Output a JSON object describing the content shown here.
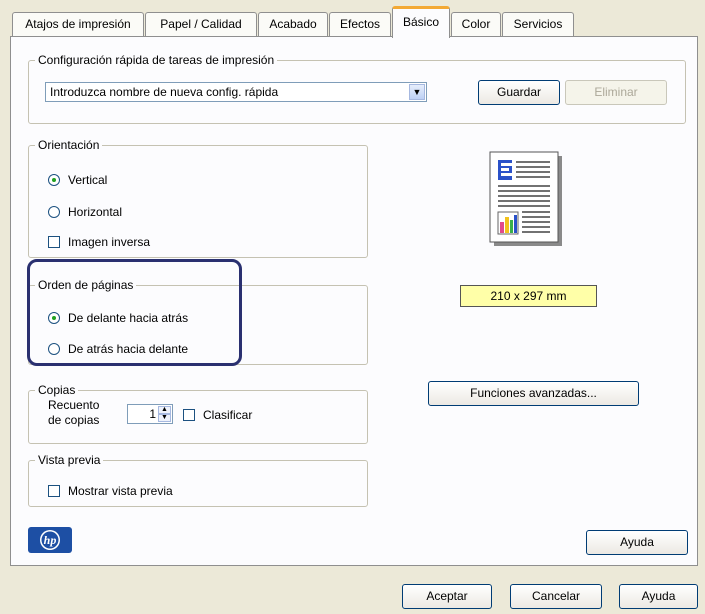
{
  "tabs": [
    {
      "label": "Atajos de impresión",
      "active": false
    },
    {
      "label": "Papel / Calidad",
      "active": false
    },
    {
      "label": "Acabado",
      "active": false
    },
    {
      "label": "Efectos",
      "active": false
    },
    {
      "label": "Básico",
      "active": true
    },
    {
      "label": "Color",
      "active": false
    },
    {
      "label": "Servicios",
      "active": false
    }
  ],
  "quick_config": {
    "title": "Configuración rápida de tareas de impresión",
    "combo_value": "Introduzca nombre de nueva config. rápida",
    "save_label": "Guardar",
    "delete_label": "Eliminar"
  },
  "orientation": {
    "title": "Orientación",
    "vertical": "Vertical",
    "horizontal": "Horizontal",
    "mirror": "Imagen inversa",
    "selected": "vertical"
  },
  "page_order": {
    "title": "Orden de páginas",
    "front_to_back": "De delante hacia atrás",
    "back_to_front": "De atrás hacia delante",
    "selected": "front_to_back"
  },
  "copies": {
    "title": "Copias",
    "count_label_line1": "Recuento",
    "count_label_line2": "de copias",
    "count_value": "1",
    "collate_label": "Clasificar"
  },
  "preview": {
    "title": "Vista previa",
    "show_label": "Mostrar vista previa"
  },
  "paper_size": "210 x 297 mm",
  "advanced_label": "Funciones avanzadas...",
  "help_label_inner": "Ayuda",
  "footer": {
    "ok_label": "Aceptar",
    "cancel_label": "Cancelar",
    "help_label": "Ayuda"
  },
  "icons": {
    "logo": "hp-logo",
    "page_preview": "document-preview-icon"
  },
  "colors": {
    "active_tab_accent": "#f3a934",
    "highlight_border": "#2a3070",
    "paper_size_bg": "#ffffa8"
  }
}
